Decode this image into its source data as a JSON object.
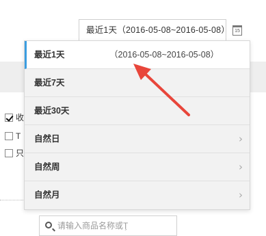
{
  "date_picker": {
    "current_value": "最近1天（2016-05-08~2016-05-08）",
    "calendar_icon_text": "15",
    "options": [
      {
        "label": "最近1天",
        "range": "（2016-05-08~2016-05-08）",
        "has_submenu": false,
        "active": true
      },
      {
        "label": "最近7天",
        "range": "",
        "has_submenu": false,
        "active": false
      },
      {
        "label": "最近30天",
        "range": "",
        "has_submenu": false,
        "active": false
      },
      {
        "label": "自然日",
        "range": "",
        "has_submenu": true,
        "active": false
      },
      {
        "label": "自然周",
        "range": "",
        "has_submenu": true,
        "active": false
      },
      {
        "label": "自然月",
        "range": "",
        "has_submenu": true,
        "active": false
      }
    ],
    "chevron": "›"
  },
  "search": {
    "placeholder": "请输入商品名称或Ţ"
  },
  "background_checkboxes": [
    {
      "label": "收",
      "checked": true
    },
    {
      "label": "T",
      "checked": false
    },
    {
      "label": "只",
      "checked": false
    }
  ],
  "colors": {
    "active_accent": "#3a9de0",
    "annotation_arrow": "#e8463b"
  }
}
